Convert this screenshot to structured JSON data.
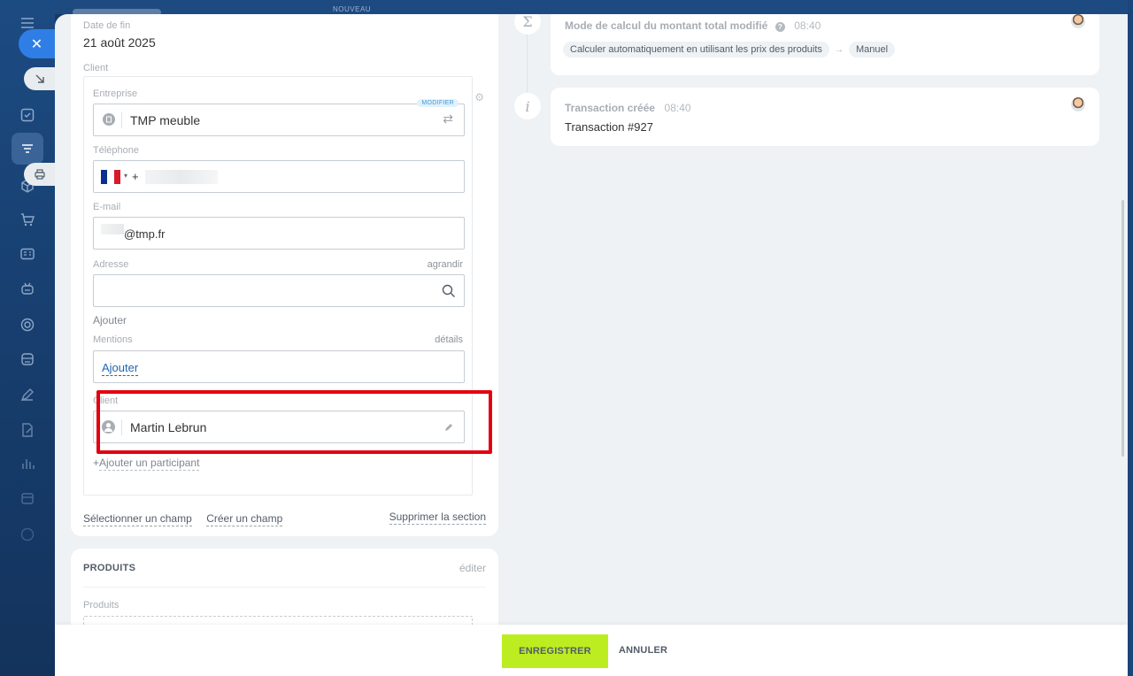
{
  "top": {
    "new_badge": "NOUVEAU"
  },
  "sidebar": {
    "icons": [
      "menu-icon",
      "close-icon",
      "filter-icon",
      "cube-icon",
      "cart-icon",
      "contact-card-icon",
      "robot-icon",
      "target-icon",
      "store-icon",
      "pen-icon",
      "edit-doc-icon",
      "chart-icon",
      "calendar-icon"
    ]
  },
  "deal": {
    "end_date_label": "Date de fin",
    "end_date_value": "21 août 2025",
    "client_section_label": "Client",
    "company_label": "Entreprise",
    "company_badge": "MODIFIER",
    "company_value": "TMP meuble",
    "phone_label": "Téléphone",
    "phone_prefix": "+",
    "email_label": "E-mail",
    "email_value": "@tmp.fr",
    "address_label": "Adresse",
    "address_expand": "agrandir",
    "add_link": "Ajouter",
    "mentions_label": "Mentions",
    "mentions_details": "détails",
    "mentions_add": "Ajouter",
    "contact_label": "Client",
    "contact_value": "Martin Lebrun",
    "add_participant": "Ajouter un participant",
    "select_field": "Sélectionner un champ",
    "create_field": "Créer un champ",
    "delete_section": "Supprimer la section"
  },
  "products": {
    "title": "PRODUITS",
    "edit": "éditer",
    "label": "Produits"
  },
  "timeline": [
    {
      "title": "Mode de calcul du montant total modifié",
      "time": "08:40",
      "from": "Calculer automatiquement en utilisant les prix des produits",
      "arrow": "→",
      "to": "Manuel"
    },
    {
      "title": "Transaction créée",
      "time": "08:40",
      "body": "Transaction #927"
    }
  ],
  "footer": {
    "save": "ENREGISTRER",
    "cancel": "ANNULER"
  },
  "colors": {
    "accent_blue": "#2f7ee6",
    "save_green": "#bbed21",
    "highlight_red": "#e3010f"
  }
}
